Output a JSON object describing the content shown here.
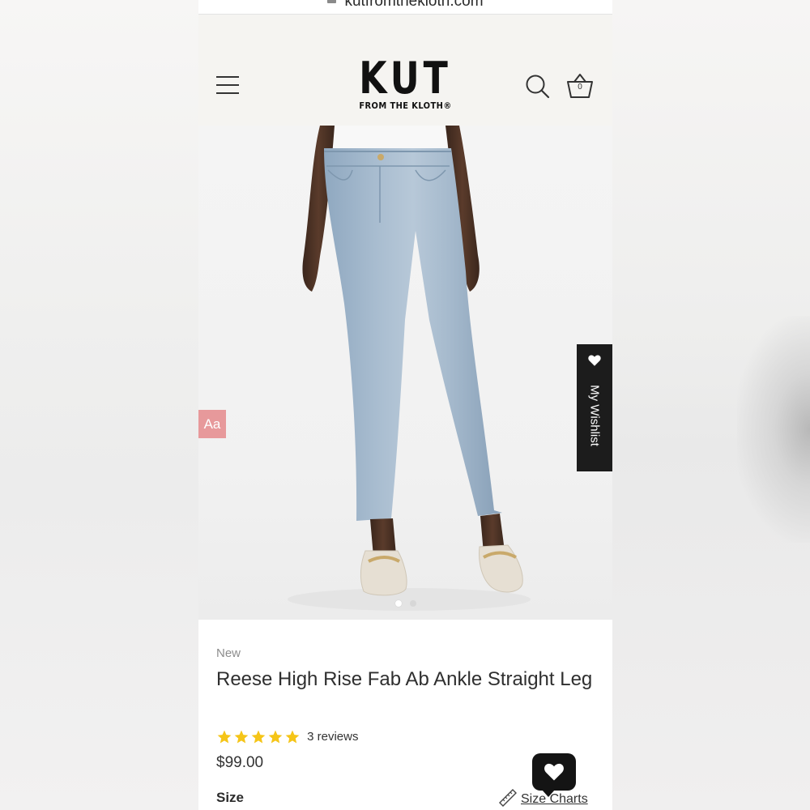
{
  "browser": {
    "url": "kutfromthekloth.com"
  },
  "header": {
    "logo_main": "KUT",
    "logo_sub": "FROM THE KLOTH®",
    "basket_count": "0",
    "menu_icon": "hamburger-menu-icon",
    "search_icon": "search-icon",
    "basket_icon": "basket-icon"
  },
  "gallery": {
    "image_subject": "model wearing light-wash ankle straight jeans with cream loafers",
    "total_images": 2,
    "active_index": 0
  },
  "accessibility": {
    "label": "Aa"
  },
  "wishlist_tab": {
    "label": "My Wishlist",
    "icon": "heart-icon"
  },
  "product": {
    "badge": "New",
    "title": "Reese High Rise Fab Ab Ankle Straight Leg",
    "rating": 5,
    "reviews_label": "3 reviews",
    "price": "$99.00",
    "size_label": "Size",
    "size_charts_label": "Size Charts",
    "size_charts_icon": "ruler-icon"
  },
  "colors": {
    "star": "#f5c518",
    "accessibility_bg": "#e7999b",
    "wishlist_bg": "#1c1c1c",
    "header_bg": "#f5f4f1"
  }
}
